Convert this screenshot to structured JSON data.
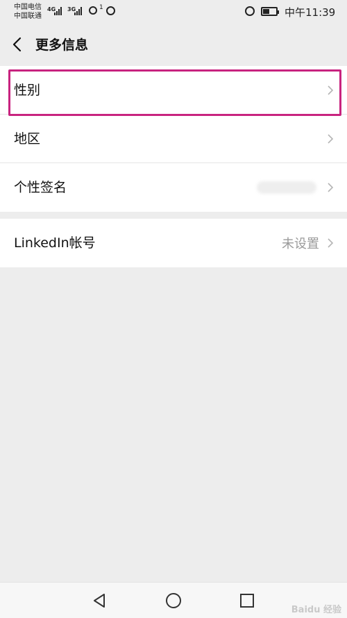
{
  "status_bar": {
    "carrier_1": "中国电信",
    "carrier_2": "中国联通",
    "net_1": "4G",
    "net_2": "3G",
    "hotspot_count": "1",
    "time": "中午11:39"
  },
  "header": {
    "title": "更多信息"
  },
  "list": {
    "group1": [
      {
        "label": "性别",
        "value": ""
      },
      {
        "label": "地区",
        "value": ""
      },
      {
        "label": "个性签名",
        "value": ""
      }
    ],
    "group2": [
      {
        "label": "LinkedIn帐号",
        "value": "未设置"
      }
    ]
  },
  "highlight_color": "#c8237f",
  "watermark": "Baidu 经验"
}
